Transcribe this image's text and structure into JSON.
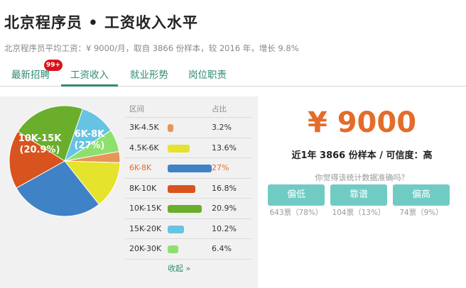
{
  "header": {
    "title": "北京程序员 • 工资收入水平",
    "subtitle": "北京程序员平均工资：¥ 9000/月，取自 3866 份样本，较 2016 年，增长 9.8%"
  },
  "tabs": [
    {
      "label": "最新招聘",
      "badge": "99+"
    },
    {
      "label": "工资收入"
    },
    {
      "label": "就业形势"
    },
    {
      "label": "岗位职责"
    }
  ],
  "active_tab": "工资收入",
  "table": {
    "header_range": "区间",
    "header_pct": "占比",
    "collapse_label": "收起 »"
  },
  "pie_labels": {
    "a_range": "6K-8K",
    "a_pct": "(27%)",
    "b_range": "10K-15K",
    "b_pct": "(20.9%)"
  },
  "chart_data": {
    "type": "pie",
    "highlighted": "6K-8K",
    "slices": [
      {
        "label": "3K-4.5K",
        "pct_text": "3.2%",
        "value": 3.2,
        "color": "#e8955a"
      },
      {
        "label": "4.5K-6K",
        "pct_text": "13.6%",
        "value": 13.6,
        "color": "#e6e32c"
      },
      {
        "label": "6K-8K",
        "pct_text": "27%",
        "value": 27,
        "color": "#3f82c6"
      },
      {
        "label": "8K-10K",
        "pct_text": "16.8%",
        "value": 16.8,
        "color": "#d9531e"
      },
      {
        "label": "10K-15K",
        "pct_text": "20.9%",
        "value": 20.9,
        "color": "#6aae2b"
      },
      {
        "label": "15K-20K",
        "pct_text": "10.2%",
        "value": 10.2,
        "color": "#67c3e3"
      },
      {
        "label": "20K-30K",
        "pct_text": "6.4%",
        "value": 6.4,
        "color": "#8ee06e"
      }
    ]
  },
  "panel": {
    "avg_salary": "¥ 9000",
    "sample_info": "近1年 3866 份样本 / 可信度：高",
    "question": "你觉得该统计数据准确吗？",
    "votes": [
      {
        "label": "偏低",
        "count": "643票（78%）"
      },
      {
        "label": "靠谱",
        "count": "104票（13%）"
      },
      {
        "label": "偏高",
        "count": "74票（9%）"
      }
    ]
  },
  "colors": {
    "accent": "#2f8a73",
    "salary": "#e46c2a",
    "button": "#70cbc4",
    "badge": "#d9121b"
  }
}
